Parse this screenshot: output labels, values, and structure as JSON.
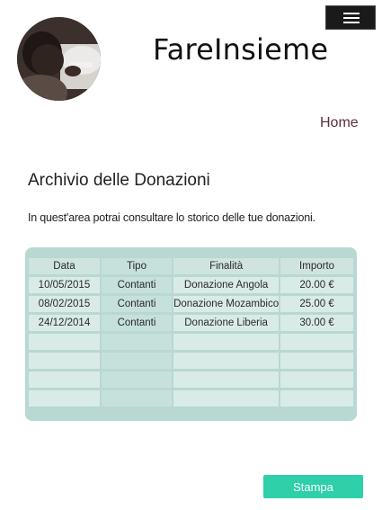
{
  "header": {
    "site_title": "FareInsieme",
    "menu_icon": "hamburger-icon",
    "avatar_description": "photo-avatar"
  },
  "nav": {
    "home_label": "Home"
  },
  "main": {
    "heading": "Archivio delle Donazioni",
    "intro": "In quest'area potrai consultare lo storico delle tue donazioni.",
    "table": {
      "columns": [
        "Data",
        "Tipo",
        "Finalità",
        "Importo"
      ],
      "rows": [
        [
          "10/05/2015",
          "Contanti",
          "Donazione Angola",
          "20.00 €"
        ],
        [
          "08/02/2015",
          "Contanti",
          "Donazione Mozambico",
          "25.00 €"
        ],
        [
          "24/12/2014",
          "Contanti",
          "Donazione Liberia",
          "30.00 €"
        ],
        [
          "",
          "",
          "",
          ""
        ],
        [
          "",
          "",
          "",
          ""
        ],
        [
          "",
          "",
          "",
          ""
        ],
        [
          "",
          "",
          "",
          ""
        ]
      ]
    },
    "print_label": "Stampa"
  },
  "colors": {
    "accent": "#2ecfa9",
    "nav_link": "#5a2e3a",
    "table_panel": "#b8d8d1",
    "menu_button": "#1a1a1a"
  }
}
